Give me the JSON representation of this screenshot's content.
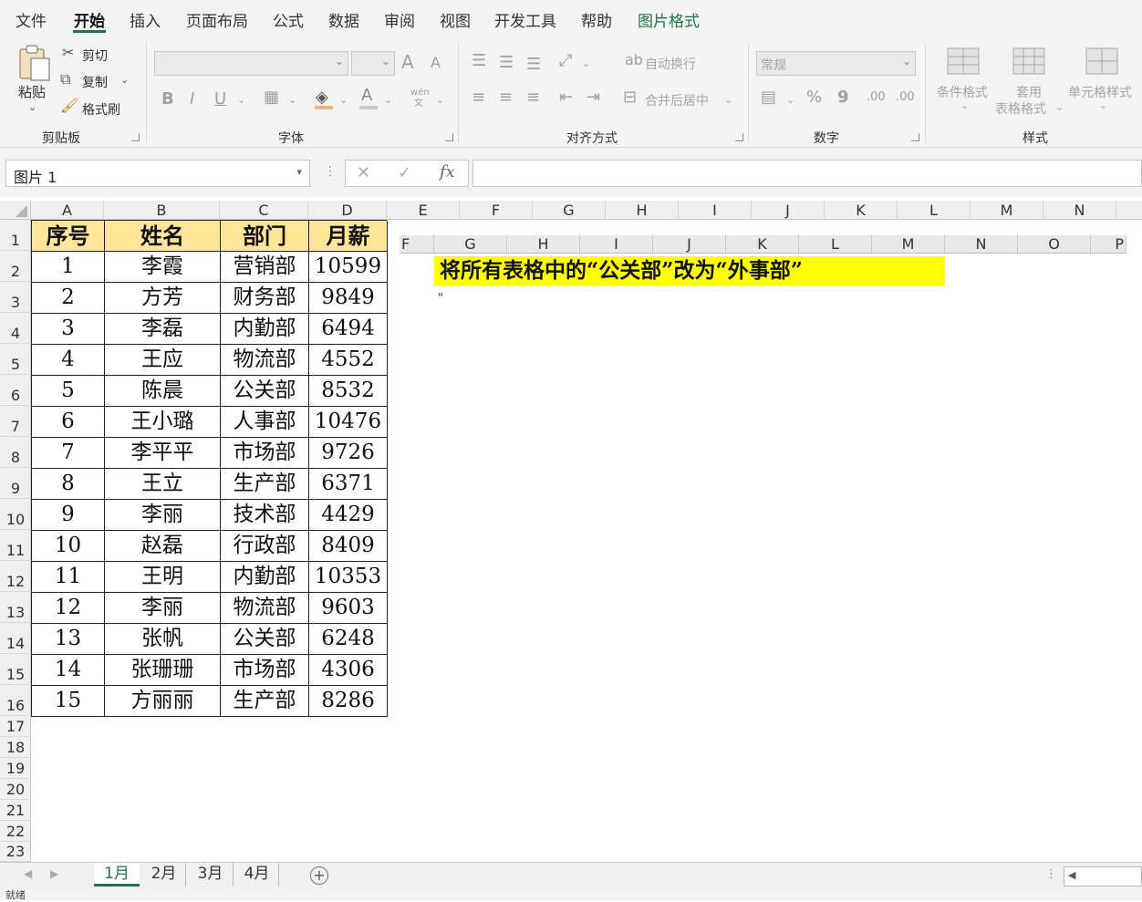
{
  "menu": {
    "tabs": [
      {
        "label": "文件"
      },
      {
        "label": "开始"
      },
      {
        "label": "插入"
      },
      {
        "label": "页面布局"
      },
      {
        "label": "公式"
      },
      {
        "label": "数据"
      },
      {
        "label": "审阅"
      },
      {
        "label": "视图"
      },
      {
        "label": "开发工具"
      },
      {
        "label": "帮助"
      },
      {
        "label": "图片格式"
      }
    ]
  },
  "ribbon": {
    "clipboard": {
      "paste": "粘贴",
      "cut": "剪切",
      "copy": "复制",
      "format_painter": "格式刷",
      "label": "剪贴板"
    },
    "font": {
      "label": "字体",
      "bold": "B",
      "italic": "I",
      "underline": "U",
      "grow": "A",
      "shrink": "A",
      "phonetic_top": "wén",
      "phonetic_bottom": "文"
    },
    "alignment": {
      "label": "对齐方式",
      "wrap": "自动换行",
      "merge": "合并后居中"
    },
    "number": {
      "label": "数字",
      "format": "常规",
      "percent": "%",
      "comma": "9",
      "inc_decimal": ".00",
      "dec_decimal": ".00"
    },
    "styles": {
      "label": "样式",
      "conditional": "条件格式",
      "table_line1": "套用",
      "table_line2": "表格格式",
      "cell_styles": "单元格样式"
    }
  },
  "formula_bar": {
    "name_box": "图片 1",
    "fx": "fx",
    "value": ""
  },
  "columns": [
    "A",
    "B",
    "C",
    "D",
    "E",
    "F",
    "G",
    "H",
    "I",
    "J",
    "K",
    "L",
    "M",
    "N"
  ],
  "rows": [
    "1",
    "2",
    "3",
    "4",
    "5",
    "6",
    "7",
    "8",
    "9",
    "10",
    "11",
    "12",
    "13",
    "14",
    "15",
    "16",
    "17",
    "18",
    "19",
    "20",
    "21",
    "22",
    "23"
  ],
  "table": {
    "headers": [
      "序号",
      "姓名",
      "部门",
      "月薪"
    ],
    "rows": [
      [
        "1",
        "李霞",
        "营销部",
        "10599"
      ],
      [
        "2",
        "方芳",
        "财务部",
        "9849"
      ],
      [
        "3",
        "李磊",
        "内勤部",
        "6494"
      ],
      [
        "4",
        "王应",
        "物流部",
        "4552"
      ],
      [
        "5",
        "陈晨",
        "公关部",
        "8532"
      ],
      [
        "6",
        "王小璐",
        "人事部",
        "10476"
      ],
      [
        "7",
        "李平平",
        "市场部",
        "9726"
      ],
      [
        "8",
        "王立",
        "生产部",
        "6371"
      ],
      [
        "9",
        "李丽",
        "技术部",
        "4429"
      ],
      [
        "10",
        "赵磊",
        "行政部",
        "8409"
      ],
      [
        "11",
        "王明",
        "内勤部",
        "10353"
      ],
      [
        "12",
        "李丽",
        "物流部",
        "9603"
      ],
      [
        "13",
        "张帆",
        "公关部",
        "6248"
      ],
      [
        "14",
        "张珊珊",
        "市场部",
        "4306"
      ],
      [
        "15",
        "方丽丽",
        "生产部",
        "8286"
      ]
    ]
  },
  "picture": {
    "columns": [
      "F",
      "G",
      "H",
      "I",
      "J",
      "K",
      "L",
      "M",
      "N",
      "O",
      "P"
    ],
    "banner": "将所有表格中的“公关部”改为“外事部”",
    "stray_mark": "\""
  },
  "sheets": [
    {
      "label": "1月"
    },
    {
      "label": "2月"
    },
    {
      "label": "3月"
    },
    {
      "label": "4月"
    }
  ],
  "status": {
    "text": "就绪"
  },
  "colors": {
    "accent": "#217346",
    "header_fill": "#ffe699",
    "banner_fill": "#ffff00"
  }
}
